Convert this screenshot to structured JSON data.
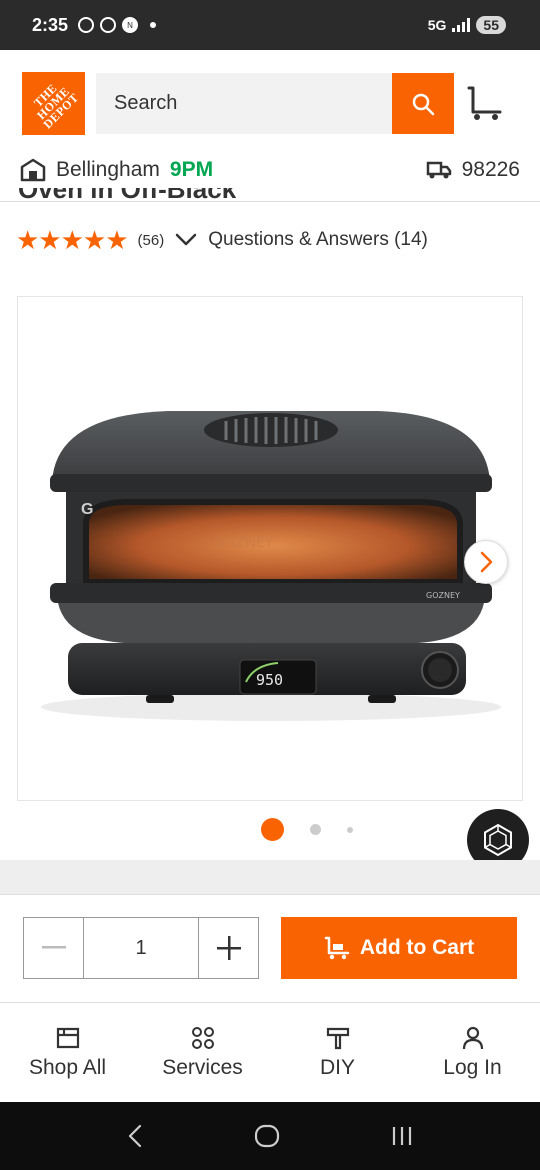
{
  "status_bar": {
    "time": "2:35",
    "network": "5G",
    "battery": "55",
    "notif_icons": [
      "facebook-icon",
      "chrome-icon",
      "news-icon",
      "dot-icon"
    ]
  },
  "header": {
    "logo_text": "THE HOME DEPOT",
    "search_placeholder": "Search",
    "store_name": "Bellingham",
    "store_hours": "9PM",
    "zip": "98226"
  },
  "product": {
    "title_fragment": "Oven in Off-Black",
    "stars": "★★★★★",
    "review_count": "(56)",
    "qa_label": "Questions & Answers (14)",
    "image_brand_mark": "G",
    "image_brand_name": "GOZNEY",
    "image_display": "950"
  },
  "gallery": {
    "total_images": 3,
    "active_index": 0
  },
  "purchase": {
    "quantity": "1",
    "add_to_cart_label": "Add to Cart"
  },
  "bottom_nav": [
    {
      "label": "Shop All",
      "icon": "shop-all-icon"
    },
    {
      "label": "Services",
      "icon": "services-icon"
    },
    {
      "label": "DIY",
      "icon": "diy-icon"
    },
    {
      "label": "Log In",
      "icon": "user-icon"
    }
  ],
  "colors": {
    "brand_orange": "#f96302",
    "open_green": "#00a650",
    "text_dark": "#333333"
  }
}
